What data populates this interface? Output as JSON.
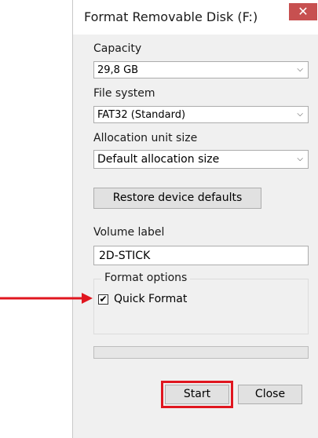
{
  "window": {
    "title": "Format Removable Disk (F:)",
    "close_glyph": "✕"
  },
  "capacity": {
    "label": "Capacity",
    "value": "29,8 GB"
  },
  "file_system": {
    "label": "File system",
    "value": "FAT32 (Standard)"
  },
  "allocation": {
    "label": "Allocation unit size",
    "value": "Default allocation size"
  },
  "restore_button": {
    "label": "Restore device defaults"
  },
  "volume": {
    "label": "Volume label",
    "value": "2D-STICK"
  },
  "format_options": {
    "legend": "Format options",
    "quick_format_label": "Quick Format",
    "quick_format_checked": true,
    "check_glyph": "✔"
  },
  "progress": {
    "value_percent": 0
  },
  "buttons": {
    "start": "Start",
    "close": "Close"
  },
  "annotations": {
    "highlight_color": "#e0161f"
  },
  "icons": {
    "dropdown": "chevron-down-icon",
    "close": "close-icon",
    "check": "checkmark-icon"
  }
}
